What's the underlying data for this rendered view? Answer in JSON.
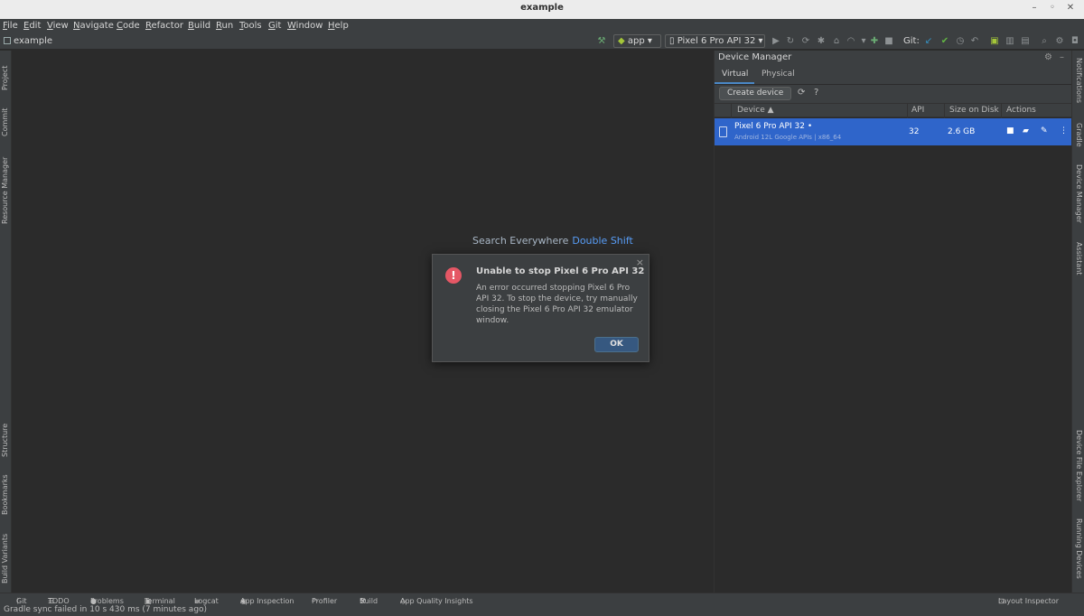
{
  "window": {
    "title": "example"
  },
  "menu": [
    "File",
    "Edit",
    "View",
    "Navigate",
    "Code",
    "Refactor",
    "Build",
    "Run",
    "Tools",
    "Git",
    "Window",
    "Help"
  ],
  "navbar": {
    "project": "example",
    "run_config": "app",
    "device": "Pixel 6 Pro API 32",
    "git_label": "Git:"
  },
  "left_tool_tabs": [
    "Project",
    "Commit",
    "Resource Manager",
    "Structure",
    "Bookmarks",
    "Build Variants"
  ],
  "right_tool_tabs": [
    "Notifications",
    "Gradle",
    "Device Manager",
    "Assistant",
    "Device File Explorer",
    "Running Devices"
  ],
  "editor": {
    "search_hint": "Search Everywhere",
    "search_key": "Double Shift"
  },
  "dialog": {
    "title": "Unable to stop Pixel 6 Pro API 32",
    "message": "An error occurred stopping Pixel 6 Pro API 32. To stop the device, try manually closing the Pixel 6 Pro API 32 emulator window.",
    "ok_label": "OK",
    "close_symbol": "×",
    "error_symbol": "!"
  },
  "device_manager": {
    "title": "Device Manager",
    "tabs": [
      "Virtual",
      "Physical"
    ],
    "active_tab": "Virtual",
    "create_label": "Create device",
    "help_symbol": "?",
    "columns": {
      "device": "Device ▲",
      "api": "API",
      "size": "Size on Disk",
      "actions": "Actions"
    },
    "rows": [
      {
        "name": "Pixel 6 Pro API 32 •",
        "subtitle": "Android 12L Google APIs | x86_64",
        "api": "32",
        "size": "2.6 GB"
      }
    ]
  },
  "bottom_tools": [
    "Git",
    "TODO",
    "Problems",
    "Terminal",
    "Logcat",
    "App Inspection",
    "Profiler",
    "Build",
    "App Quality Insights"
  ],
  "bottom_right_tool": "Layout Inspector",
  "status": {
    "text": "Gradle sync failed in 10 s 430 ms (7 minutes ago)"
  },
  "colors": {
    "accent": "#2f65ca",
    "error": "#e55765",
    "link": "#589df6",
    "ok_button": "#365880"
  }
}
